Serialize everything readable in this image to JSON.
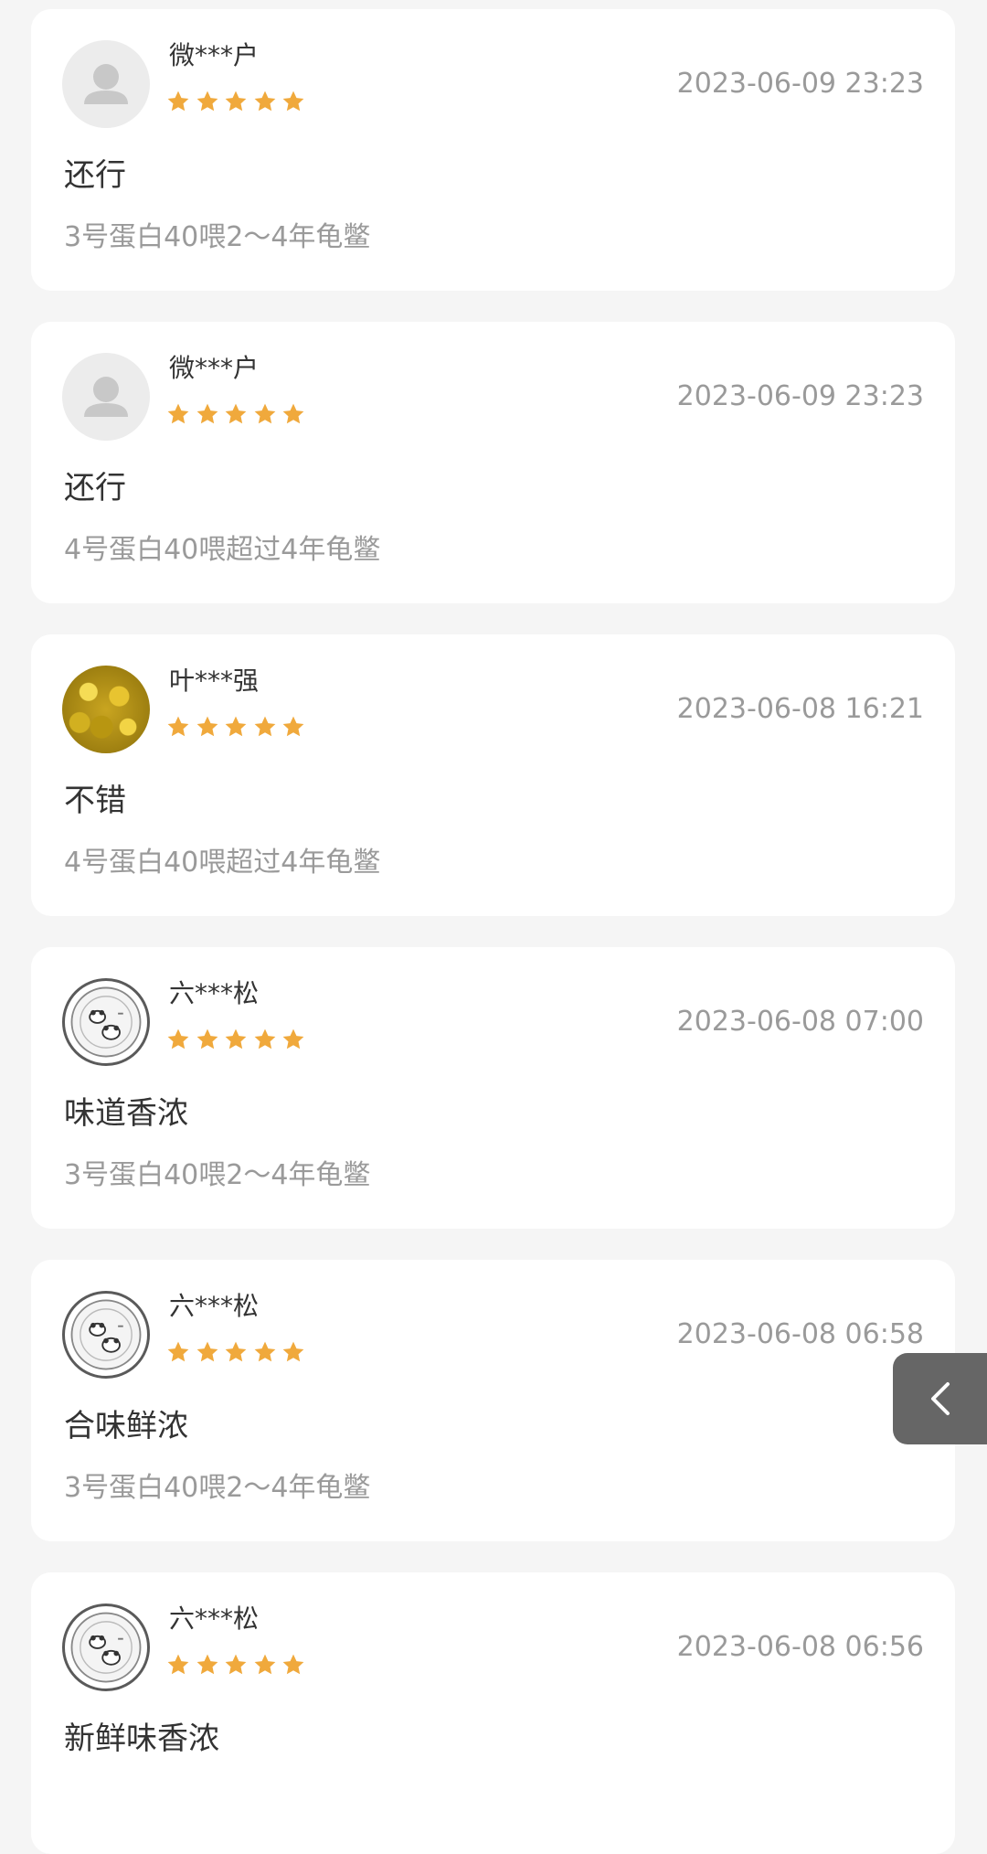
{
  "reviews": [
    {
      "user": "微***户",
      "date": "2023-06-09 23:23",
      "rating": 5,
      "text": "还行",
      "spec": "3号蛋白40喂2～4年龟鳖",
      "avatar": "default-avatar-icon"
    },
    {
      "user": "微***户",
      "date": "2023-06-09 23:23",
      "rating": 5,
      "text": "还行",
      "spec": "4号蛋白40喂超过4年龟鳖",
      "avatar": "default-avatar-icon"
    },
    {
      "user": "叶***强",
      "date": "2023-06-08 16:21",
      "rating": 5,
      "text": "不错",
      "spec": "4号蛋白40喂超过4年龟鳖",
      "avatar": "yellow-flowers-avatar"
    },
    {
      "user": "六***松",
      "date": "2023-06-08 07:00",
      "rating": 5,
      "text": "味道香浓",
      "spec": "3号蛋白40喂2～4年龟鳖",
      "avatar": "panda-coin-avatar"
    },
    {
      "user": "六***松",
      "date": "2023-06-08 06:58",
      "rating": 5,
      "text": "合味鲜浓",
      "spec": "3号蛋白40喂2～4年龟鳖",
      "avatar": "panda-coin-avatar"
    },
    {
      "user": "六***松",
      "date": "2023-06-08 06:56",
      "rating": 5,
      "text": "新鲜味香浓",
      "spec": "",
      "avatar": "panda-coin-avatar"
    }
  ],
  "colors": {
    "star": "#F0A93C",
    "page_background": "#F5F5F5",
    "card_background": "#FFFFFF",
    "secondary_text": "#9A9A9A",
    "side_tab": "#666666"
  },
  "side_tab": {
    "icon": "chevron-left-icon"
  }
}
